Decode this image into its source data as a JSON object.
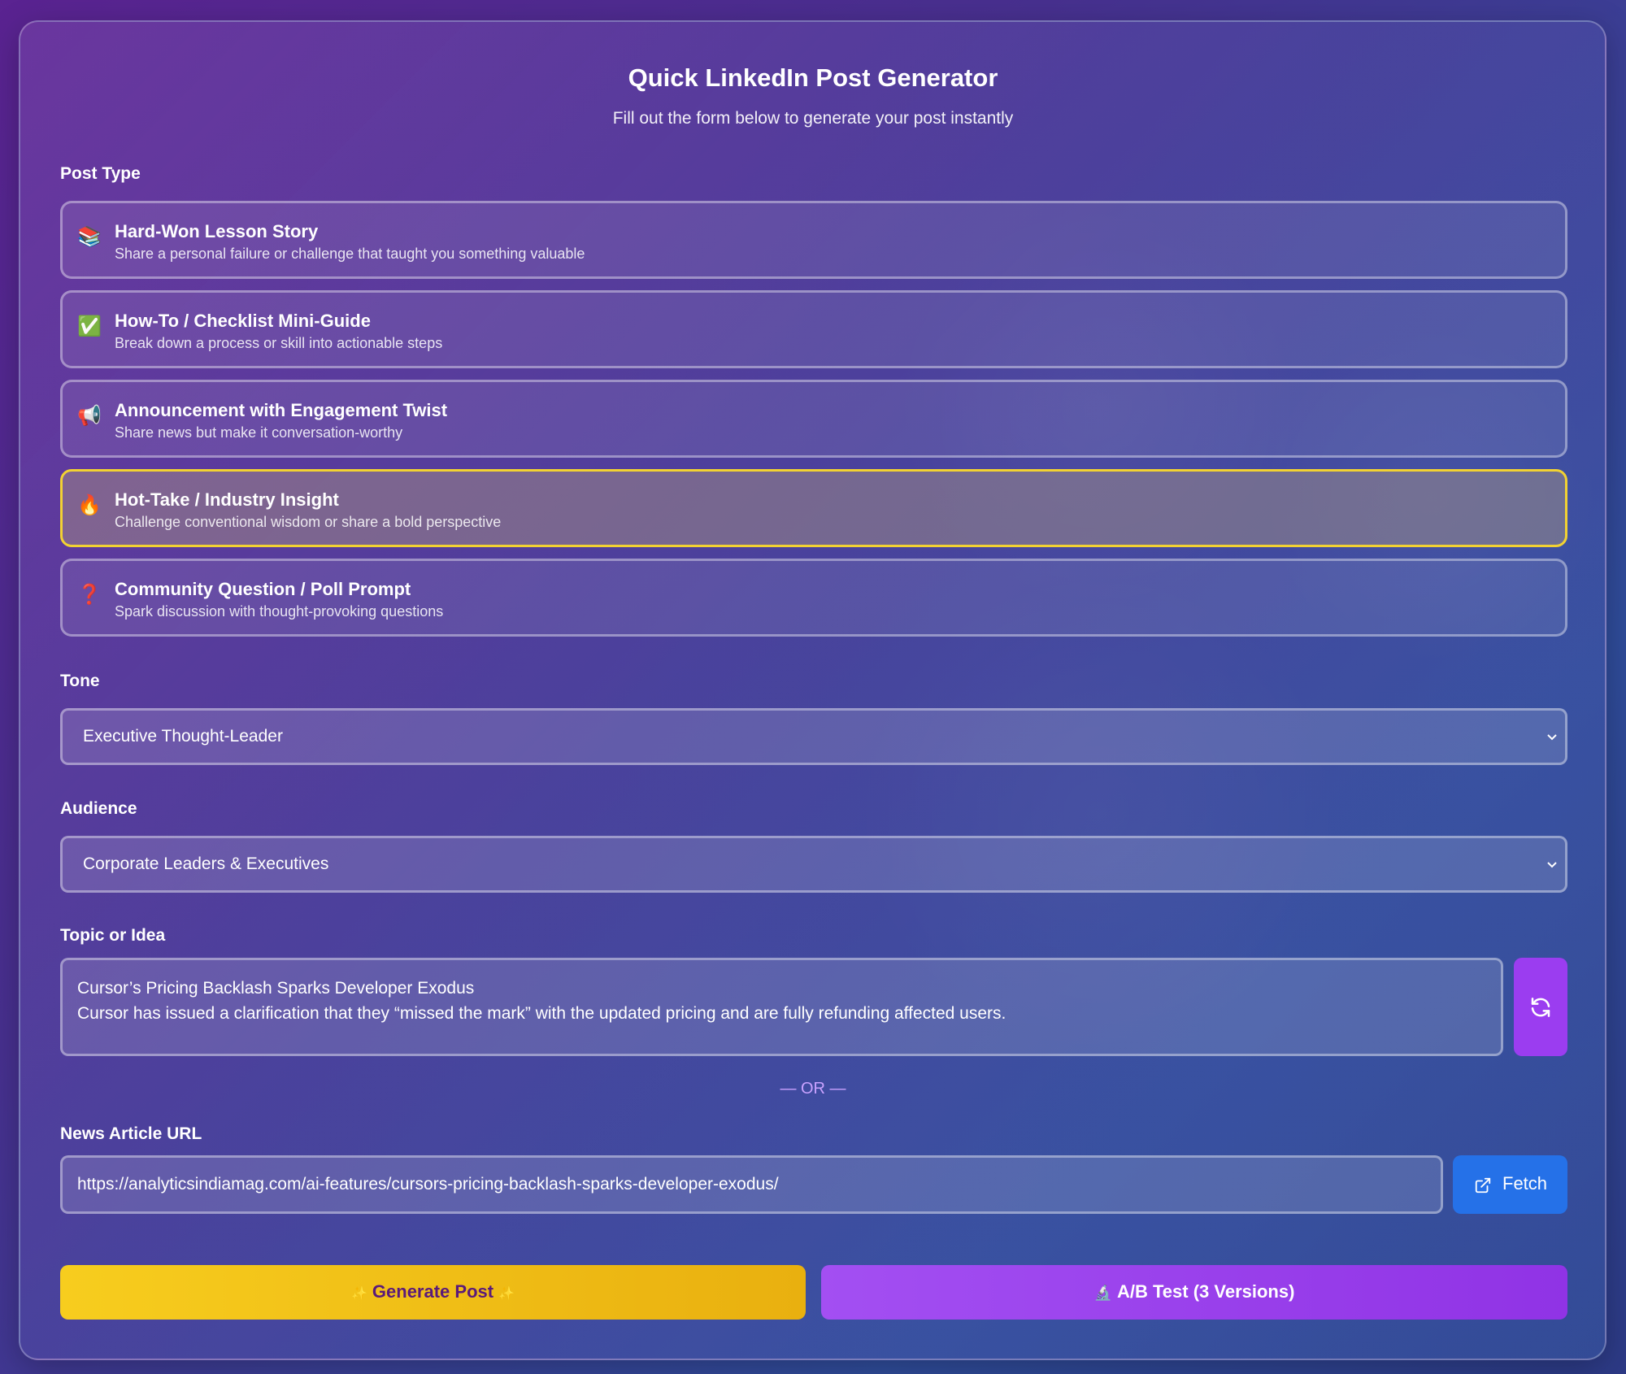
{
  "header": {
    "title": "Quick LinkedIn Post Generator",
    "subtitle": "Fill out the form below to generate your post instantly"
  },
  "post_type": {
    "label": "Post Type",
    "selected_index": 3,
    "options": [
      {
        "icon": "books-icon",
        "glyph": "📚",
        "title": "Hard-Won Lesson Story",
        "description": "Share a personal failure or challenge that taught you something valuable"
      },
      {
        "icon": "check-mark-icon",
        "glyph": "✅",
        "title": "How-To / Checklist Mini-Guide",
        "description": "Break down a process or skill into actionable steps"
      },
      {
        "icon": "megaphone-icon",
        "glyph": "📢",
        "title": "Announcement with Engagement Twist",
        "description": "Share news but make it conversation-worthy"
      },
      {
        "icon": "fire-icon",
        "glyph": "🔥",
        "title": "Hot-Take / Industry Insight",
        "description": "Challenge conventional wisdom or share a bold perspective"
      },
      {
        "icon": "question-mark-icon",
        "glyph": "❓",
        "title": "Community Question / Poll Prompt",
        "description": "Spark discussion with thought-provoking questions"
      }
    ]
  },
  "tone": {
    "label": "Tone",
    "value": "Executive Thought-Leader"
  },
  "audience": {
    "label": "Audience",
    "value": "Corporate Leaders & Executives"
  },
  "topic": {
    "label": "Topic or Idea",
    "value_line1": "Cursor’s Pricing Backlash Sparks Developer Exodus",
    "value_line2": "Cursor has issued a clarification that they “missed the mark” with the updated pricing and are fully refunding affected users."
  },
  "or_divider": "— OR —",
  "news_url": {
    "label": "News Article URL",
    "value": "https://analyticsindiamag.com/ai-features/cursors-pricing-backlash-sparks-developer-exodus/",
    "fetch_label": "Fetch"
  },
  "actions": {
    "generate_label": "Generate Post",
    "ab_test_label": "A/B Test (3 Versions)"
  },
  "colors": {
    "selected_border": "#f2d232",
    "refresh_button": "#9b3df0",
    "fetch_button": "#2571e8",
    "generate_button": "#f7cd1e",
    "ab_button": "#a34ff2"
  }
}
